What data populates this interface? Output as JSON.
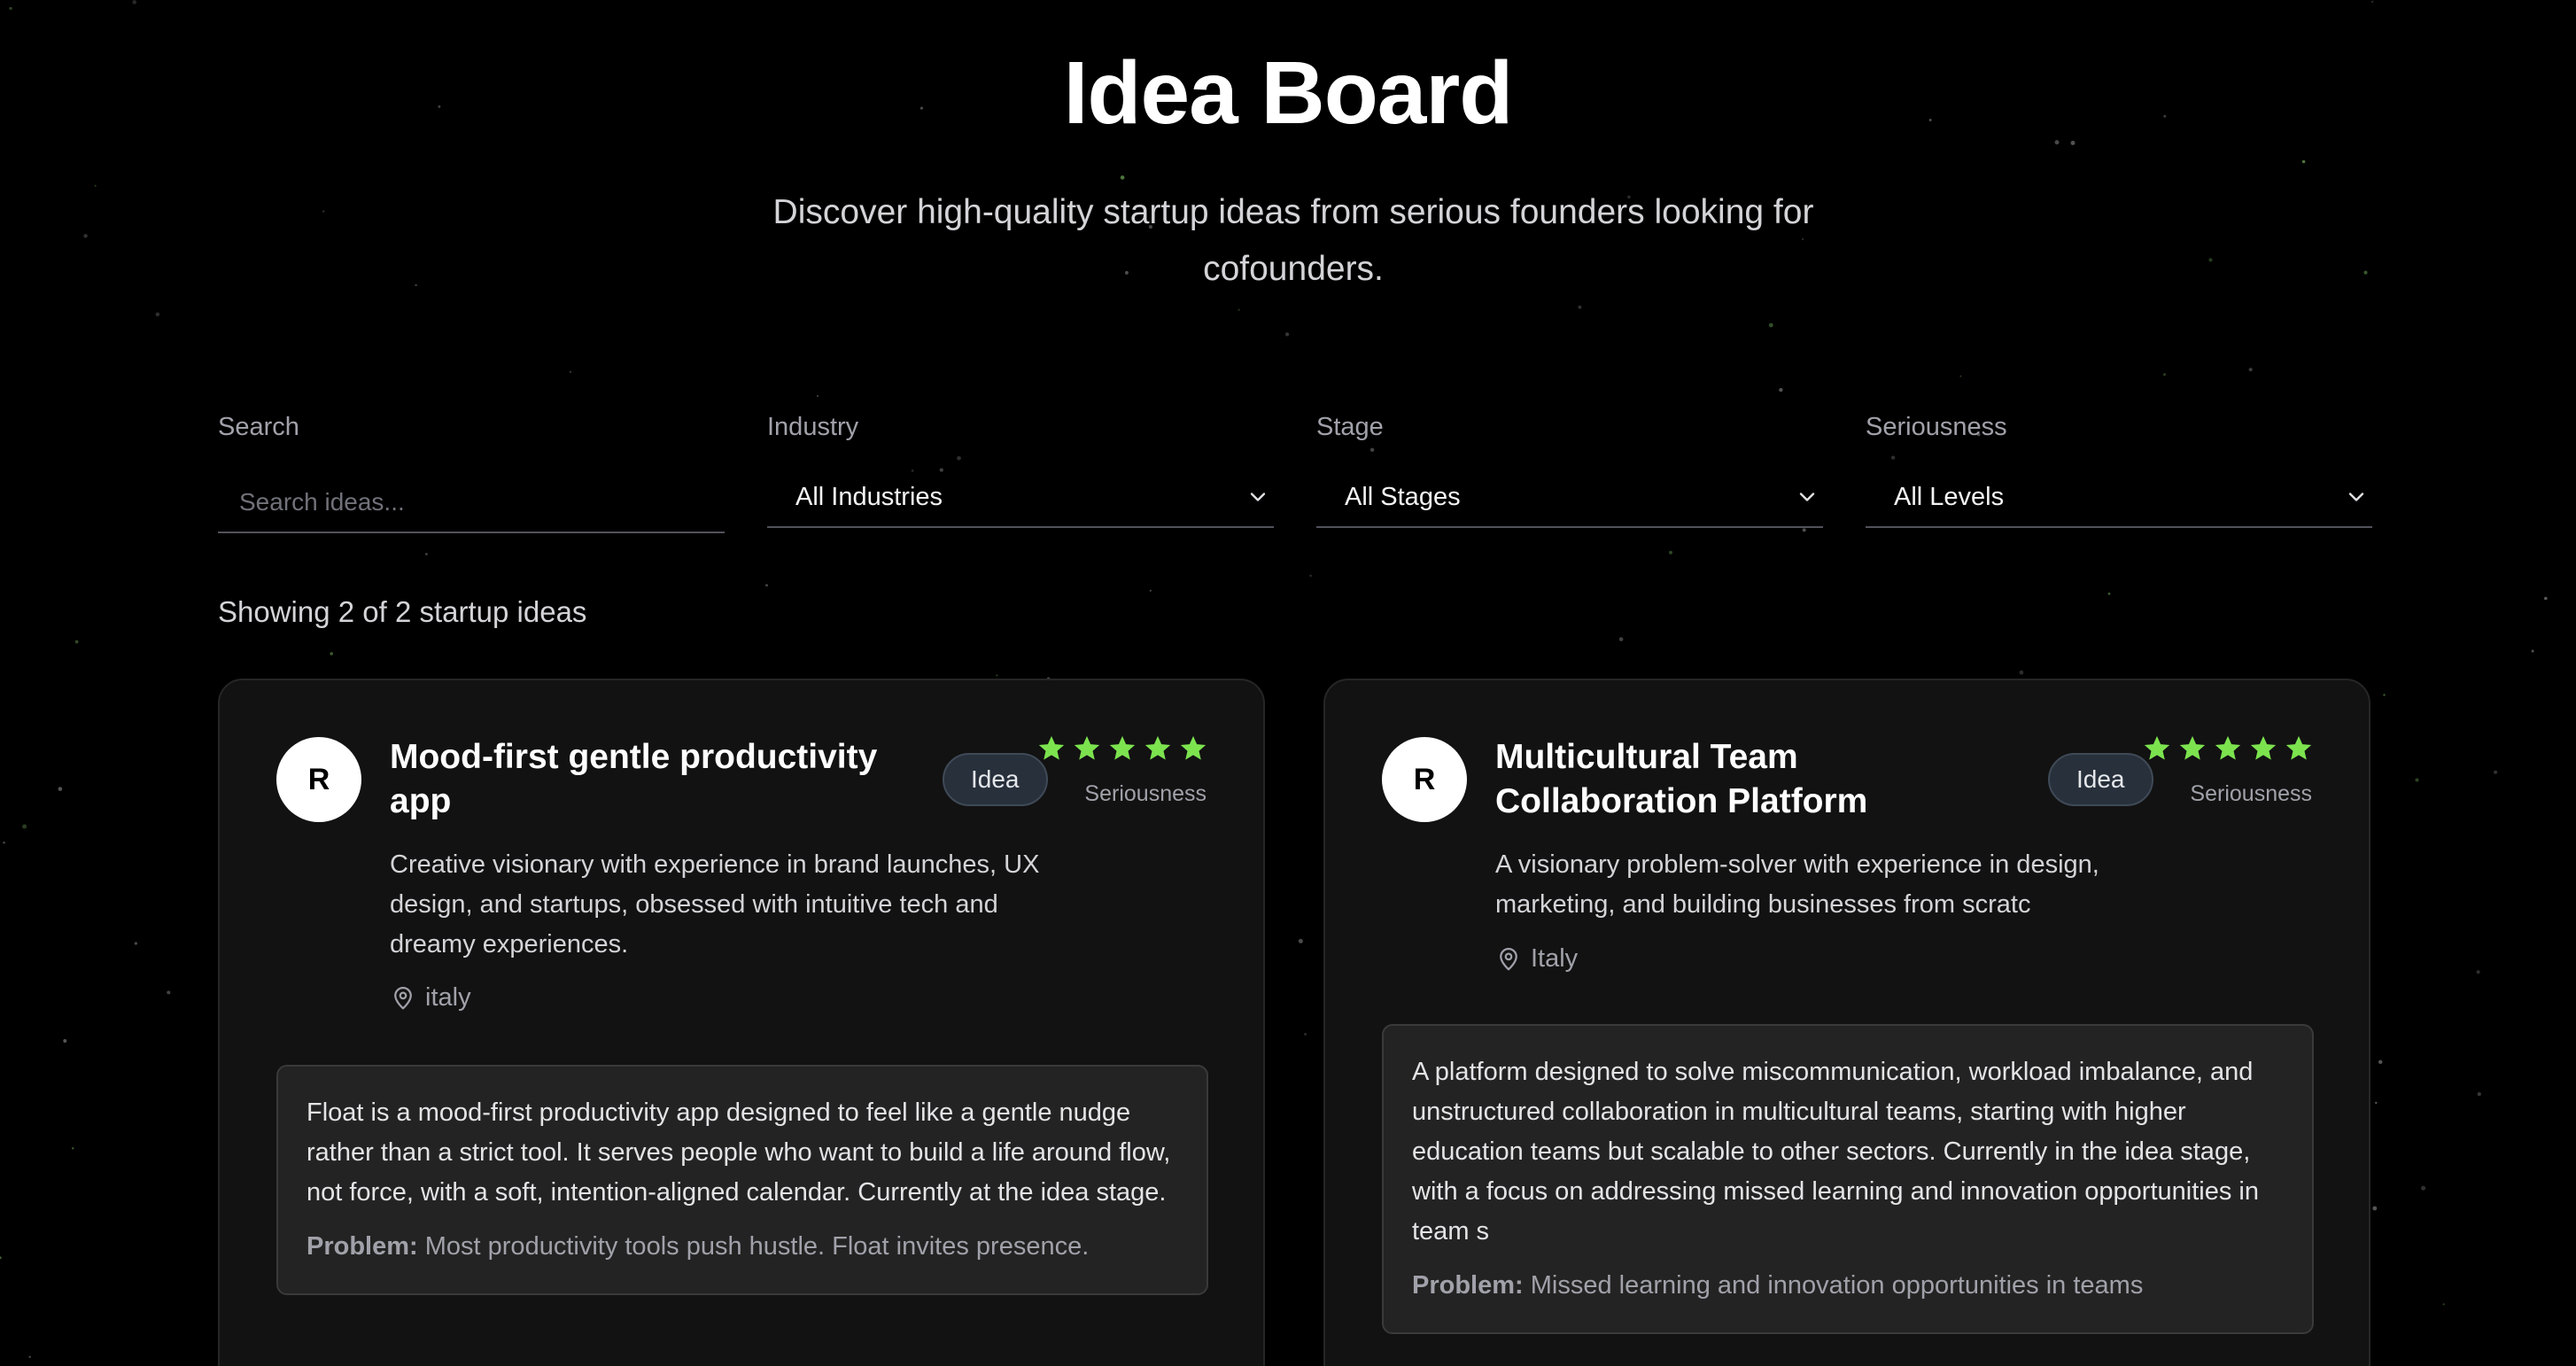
{
  "header": {
    "title": "Idea Board",
    "subtitle": "Discover high-quality startup ideas from serious founders looking for cofounders."
  },
  "filters": {
    "search": {
      "label": "Search",
      "placeholder": "Search ideas..."
    },
    "industry": {
      "label": "Industry",
      "value": "All Industries"
    },
    "stage": {
      "label": "Stage",
      "value": "All Stages"
    },
    "seriousness": {
      "label": "Seriousness",
      "value": "All Levels"
    }
  },
  "results_count": "Showing 2 of 2 startup ideas",
  "colors": {
    "star": "#7ce34f",
    "background": "#000000",
    "card": "#121212"
  },
  "ideas": [
    {
      "avatar_initial": "R",
      "title": "Mood-first gentle productivity app",
      "badge": "Idea",
      "stars": 5,
      "seriousness_label": "Seriousness",
      "founder_bio": "Creative visionary with experience in brand launches, UX design, and startups, obsessed with intuitive tech and dreamy experiences.",
      "location": "italy",
      "description": "Float is a mood-first productivity app designed to feel like a gentle nudge rather than a strict tool. It serves people who want to build a life around flow, not force, with a soft, intention-aligned calendar. Currently at the idea stage.",
      "problem_label": "Problem:",
      "problem": "Most productivity tools push hustle. Float invites presence."
    },
    {
      "avatar_initial": "R",
      "title": "Multicultural Team Collaboration Platform",
      "badge": "Idea",
      "stars": 5,
      "seriousness_label": "Seriousness",
      "founder_bio": "A visionary problem-solver with experience in design, marketing, and building businesses from scratc",
      "location": "Italy",
      "description": "A platform designed to solve miscommunication, workload imbalance, and unstructured collaboration in multicultural teams, starting with higher education teams but scalable to other sectors. Currently in the idea stage, with a focus on addressing missed learning and innovation opportunities in team s",
      "problem_label": "Problem:",
      "problem": "Missed learning and innovation opportunities in teams"
    }
  ]
}
